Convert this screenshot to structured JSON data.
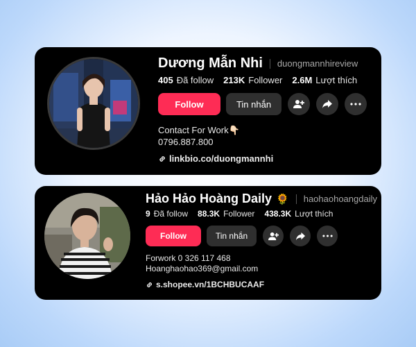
{
  "profiles": [
    {
      "display_name": "Dương Mẫn Nhi",
      "username": "duongmannhireview",
      "badge": "",
      "stats": [
        {
          "value": "405",
          "label": "Đã follow"
        },
        {
          "value": "213K",
          "label": "Follower"
        },
        {
          "value": "2.6M",
          "label": "Lượt thích"
        }
      ],
      "follow_label": "Follow",
      "message_label": "Tin nhắn",
      "bio_line1": "Contact For Work👇🏻",
      "bio_line2": "0796.887.800",
      "link": "linkbio.co/duongmannhi"
    },
    {
      "display_name": "Hảo Hảo Hoàng Daily",
      "username": "haohaohoangdaily",
      "badge": "🌻",
      "stats": [
        {
          "value": "9",
          "label": "Đã follow"
        },
        {
          "value": "88.3K",
          "label": "Follower"
        },
        {
          "value": "438.3K",
          "label": "Lượt thích"
        }
      ],
      "follow_label": "Follow",
      "message_label": "Tin nhắn",
      "bio_line1": "Forwork 0 326 117 468",
      "bio_line2": "Hoanghaohao369@gmail.com",
      "link": "s.shopee.vn/1BCHBUCAAF"
    }
  ],
  "colors": {
    "accent": "#fe2c55",
    "card_bg": "#000000",
    "secondary_btn": "#2f2f2f"
  }
}
